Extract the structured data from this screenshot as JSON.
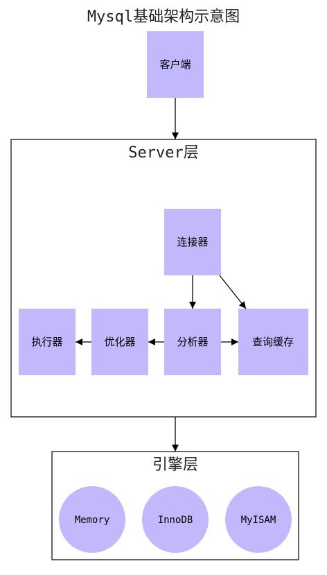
{
  "title": "Mysql基础架构示意图",
  "colors": {
    "node_fill": "#c2b8fc",
    "border": "#000000",
    "background": "#ffffff"
  },
  "nodes": {
    "client": "客户端",
    "connector": "连接器",
    "query_cache": "查询缓存",
    "analyzer": "分析器",
    "optimizer": "优化器",
    "executor": "执行器"
  },
  "server_layer": {
    "label": "Server层"
  },
  "engine_layer": {
    "label": "引擎层",
    "engines": [
      "Memory",
      "InnoDB",
      "MyISAM"
    ]
  }
}
